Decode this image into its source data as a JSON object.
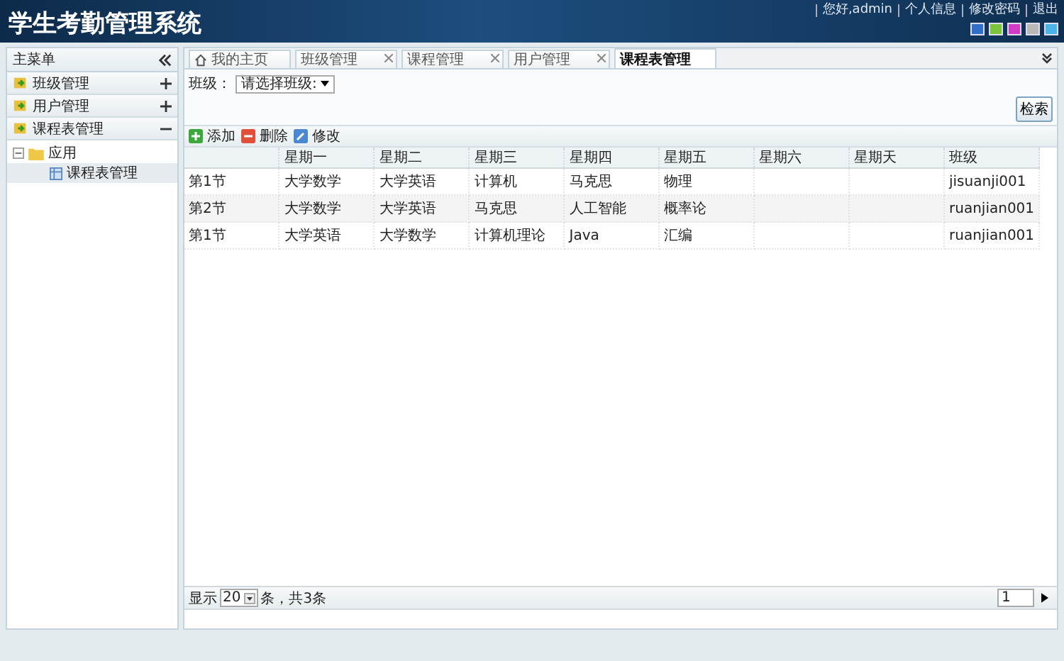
{
  "header": {
    "title": "学生考勤管理系统",
    "user_links": [
      "您好,admin",
      "个人信息",
      "修改密码",
      "退出"
    ],
    "theme_swatches": [
      {
        "color": "#2f6fc8"
      },
      {
        "color": "#7cc43a"
      },
      {
        "color": "#d03cc8"
      },
      {
        "color": "#b8b8b8"
      },
      {
        "color": "#4ab4e8"
      }
    ]
  },
  "sidebar": {
    "title": "主菜单",
    "sections": [
      {
        "label": "班级管理",
        "expanded": false
      },
      {
        "label": "用户管理",
        "expanded": false
      },
      {
        "label": "课程表管理",
        "expanded": true,
        "tree": [
          {
            "label": "应用",
            "expanded": true,
            "children": [
              {
                "label": "课程表管理",
                "selected": true
              }
            ]
          }
        ]
      }
    ]
  },
  "tabs": [
    {
      "label": "我的主页",
      "kind": "home",
      "selected": false,
      "closable": false
    },
    {
      "label": "班级管理",
      "kind": "page",
      "selected": false,
      "closable": true
    },
    {
      "label": "课程管理",
      "kind": "page",
      "selected": false,
      "closable": true
    },
    {
      "label": "用户管理",
      "kind": "page",
      "selected": false,
      "closable": true
    },
    {
      "label": "课程表管理",
      "kind": "page",
      "selected": true,
      "closable": false
    }
  ],
  "filter": {
    "label": "班级：",
    "select_value": "请选择班级:",
    "search_button": "检索"
  },
  "actions": [
    {
      "label": "添加",
      "kind": "add"
    },
    {
      "label": "删除",
      "kind": "delete"
    },
    {
      "label": "修改",
      "kind": "edit"
    }
  ],
  "table": {
    "columns": [
      null,
      "星期一",
      "星期二",
      "星期三",
      "星期四",
      "星期五",
      "星期六",
      "星期天",
      "班级"
    ],
    "rows": [
      {
        "cells": [
          "第1节",
          "大学数学",
          "大学英语",
          "计算机",
          "马克思",
          "物理",
          null,
          null,
          "jisuanji001"
        ]
      },
      {
        "cells": [
          "第2节",
          "大学数学",
          "大学英语",
          "马克思",
          "人工智能",
          "概率论",
          null,
          null,
          "ruanjian001"
        ]
      },
      {
        "cells": [
          "第1节",
          "大学英语",
          "大学数学",
          "计算机理论",
          "Java",
          "汇编",
          null,
          null,
          "ruanjian001"
        ]
      }
    ]
  },
  "pagination": {
    "show_label": "显示",
    "page_size": "20",
    "summary": "条，共3条",
    "page": "1"
  }
}
